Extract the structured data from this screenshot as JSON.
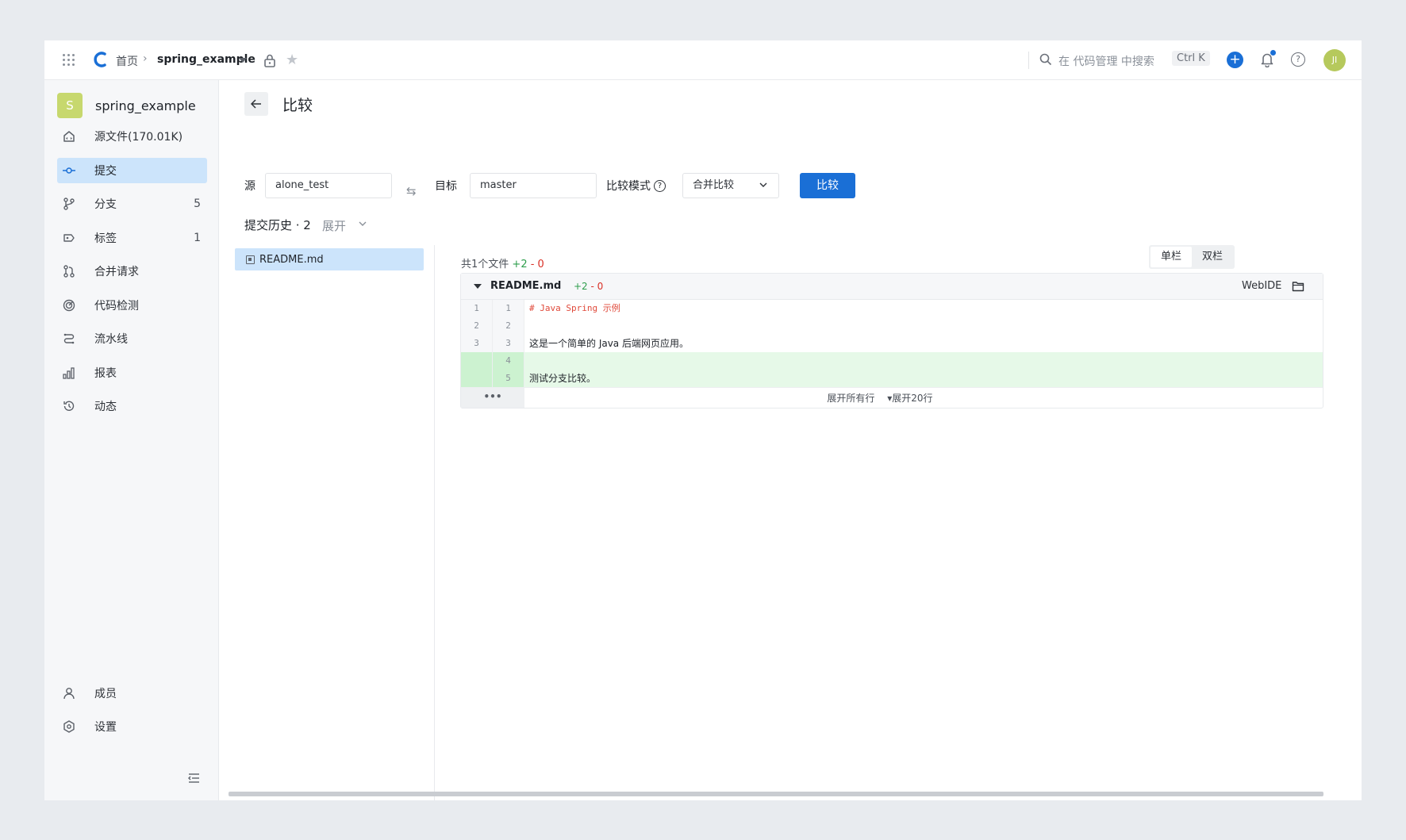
{
  "topbar": {
    "home": "首页",
    "separator": "›",
    "repo": "spring_example",
    "search_placeholder": "在 代码管理 中搜索",
    "shortcut": "Ctrl K",
    "avatar_initials": "JI"
  },
  "sidebar": {
    "repo_initial": "S",
    "repo_name": "spring_example",
    "items": [
      {
        "label": "源文件(170.01K)",
        "count": "",
        "icon": "home-code-icon"
      },
      {
        "label": "提交",
        "count": "",
        "icon": "commit-icon",
        "active": true
      },
      {
        "label": "分支",
        "count": "5",
        "icon": "branch-icon"
      },
      {
        "label": "标签",
        "count": "1",
        "icon": "tag-icon"
      },
      {
        "label": "合并请求",
        "count": "",
        "icon": "merge-request-icon"
      },
      {
        "label": "代码检测",
        "count": "",
        "icon": "scan-icon"
      },
      {
        "label": "流水线",
        "count": "",
        "icon": "pipeline-icon"
      },
      {
        "label": "报表",
        "count": "",
        "icon": "chart-icon"
      },
      {
        "label": "动态",
        "count": "",
        "icon": "history-icon"
      }
    ],
    "bottom": [
      {
        "label": "成员",
        "icon": "user-icon"
      },
      {
        "label": "设置",
        "icon": "settings-icon"
      }
    ]
  },
  "main": {
    "title": "比较",
    "source_label": "源",
    "source_value": "alone_test",
    "target_label": "目标",
    "target_value": "master",
    "mode_label": "比较模式",
    "mode_value": "合并比较",
    "compare_button": "比较",
    "history_title": "提交历史 · 2",
    "history_expand": "展开"
  },
  "tree": {
    "selected_file": "README.md"
  },
  "diff": {
    "summary_prefix": "共1个文件",
    "added": "+2",
    "removed": "- 0",
    "view_single": "单栏",
    "view_split": "双栏",
    "file_name": "README.md",
    "file_added": "+2",
    "file_removed": "- 0",
    "webide": "WebIDE",
    "lines": [
      {
        "old": "1",
        "new": "1",
        "text": "# Java Spring 示例"
      },
      {
        "old": "2",
        "new": "2",
        "text": ""
      },
      {
        "old": "3",
        "new": "3",
        "text": "这是一个简单的 Java 后端网页应用。"
      },
      {
        "old": "",
        "new": "4",
        "text": ""
      },
      {
        "old": "",
        "new": "5",
        "text": "测试分支比较。"
      }
    ],
    "expand_dots": "•••",
    "expand_all": "展开所有行",
    "expand_20": "▾展开20行"
  },
  "colors": {
    "primary": "#1a6fd6",
    "active_bg": "#cce4fb",
    "added_bg": "#e6f9e8",
    "added_text": "#2e9e4c",
    "removed_text": "#d93026"
  }
}
